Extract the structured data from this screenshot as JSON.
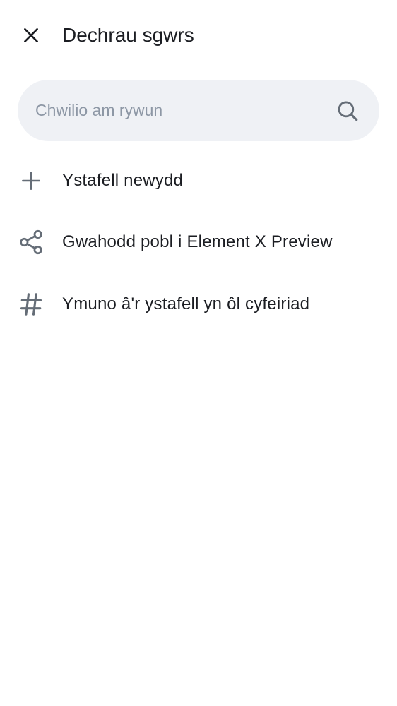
{
  "header": {
    "title": "Dechrau sgwrs",
    "close_icon": "close-icon"
  },
  "search": {
    "placeholder": "Chwilio am rywun",
    "value": "",
    "icon": "search-icon"
  },
  "actions": [
    {
      "label": "Ystafell newydd",
      "icon": "plus-icon"
    },
    {
      "label": "Gwahodd pobl i Element X Preview",
      "icon": "share-icon"
    },
    {
      "label": "Ymuno â'r ystafell yn ôl cyfeiriad",
      "icon": "hashtag-icon"
    }
  ],
  "colors": {
    "text": "#1b1d22",
    "icon": "#656d77",
    "search_background": "#eff1f5",
    "placeholder": "#8d97a5"
  }
}
